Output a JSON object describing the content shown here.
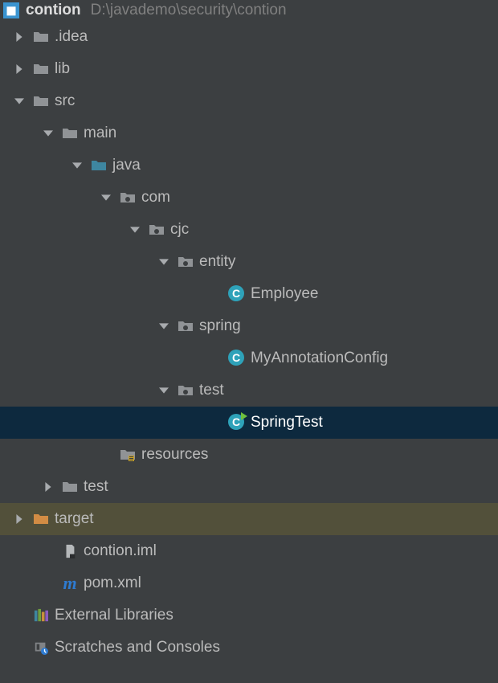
{
  "project": {
    "name": "contion",
    "path": "D:\\javademo\\security\\contion"
  },
  "colors": {
    "bg": "#3c3f41",
    "selected": "#0d293e",
    "excluded": "#52503a",
    "text": "#bbbbbb",
    "folder": "#909396",
    "source": "#3e86a0",
    "target": "#d28c44",
    "class": "#2ea2b9",
    "maven": "#2e7bd1"
  },
  "tree": [
    {
      "id": "idea",
      "indent": 14,
      "chev": "right",
      "icon": "folder",
      "label": ".idea"
    },
    {
      "id": "lib",
      "indent": 14,
      "chev": "right",
      "icon": "folder",
      "label": "lib"
    },
    {
      "id": "src",
      "indent": 14,
      "chev": "down",
      "icon": "folder",
      "label": "src"
    },
    {
      "id": "main",
      "indent": 50,
      "chev": "down",
      "icon": "folder",
      "label": "main"
    },
    {
      "id": "java",
      "indent": 86,
      "chev": "down",
      "icon": "source-root",
      "label": "java"
    },
    {
      "id": "com",
      "indent": 122,
      "chev": "down",
      "icon": "package",
      "label": "com"
    },
    {
      "id": "cjc",
      "indent": 158,
      "chev": "down",
      "icon": "package",
      "label": "cjc"
    },
    {
      "id": "entity",
      "indent": 194,
      "chev": "down",
      "icon": "package",
      "label": "entity"
    },
    {
      "id": "Employee",
      "indent": 258,
      "chev": "",
      "icon": "class",
      "label": "Employee"
    },
    {
      "id": "spring",
      "indent": 194,
      "chev": "down",
      "icon": "package",
      "label": "spring"
    },
    {
      "id": "MyAnnotationConfig",
      "indent": 258,
      "chev": "",
      "icon": "class",
      "label": "MyAnnotationConfig"
    },
    {
      "id": "testpkg",
      "indent": 194,
      "chev": "down",
      "icon": "package",
      "label": "test"
    },
    {
      "id": "SpringTest",
      "indent": 258,
      "chev": "",
      "icon": "class-run",
      "label": "SpringTest",
      "selected": true
    },
    {
      "id": "resources",
      "indent": 122,
      "chev": "",
      "icon": "resources",
      "label": "resources"
    },
    {
      "id": "test",
      "indent": 50,
      "chev": "right",
      "icon": "folder",
      "label": "test"
    },
    {
      "id": "target",
      "indent": 14,
      "chev": "right",
      "icon": "target",
      "label": "target",
      "excluded": true
    },
    {
      "id": "contion-iml",
      "indent": 50,
      "chev": "",
      "icon": "iml",
      "label": "contion.iml"
    },
    {
      "id": "pom-xml",
      "indent": 50,
      "chev": "",
      "icon": "maven",
      "label": "pom.xml"
    },
    {
      "id": "ext-lib",
      "indent": 14,
      "chev": "",
      "icon": "libs",
      "label": "External Libraries"
    },
    {
      "id": "scratches",
      "indent": 14,
      "chev": "",
      "icon": "scratch",
      "label": "Scratches and Consoles"
    }
  ]
}
